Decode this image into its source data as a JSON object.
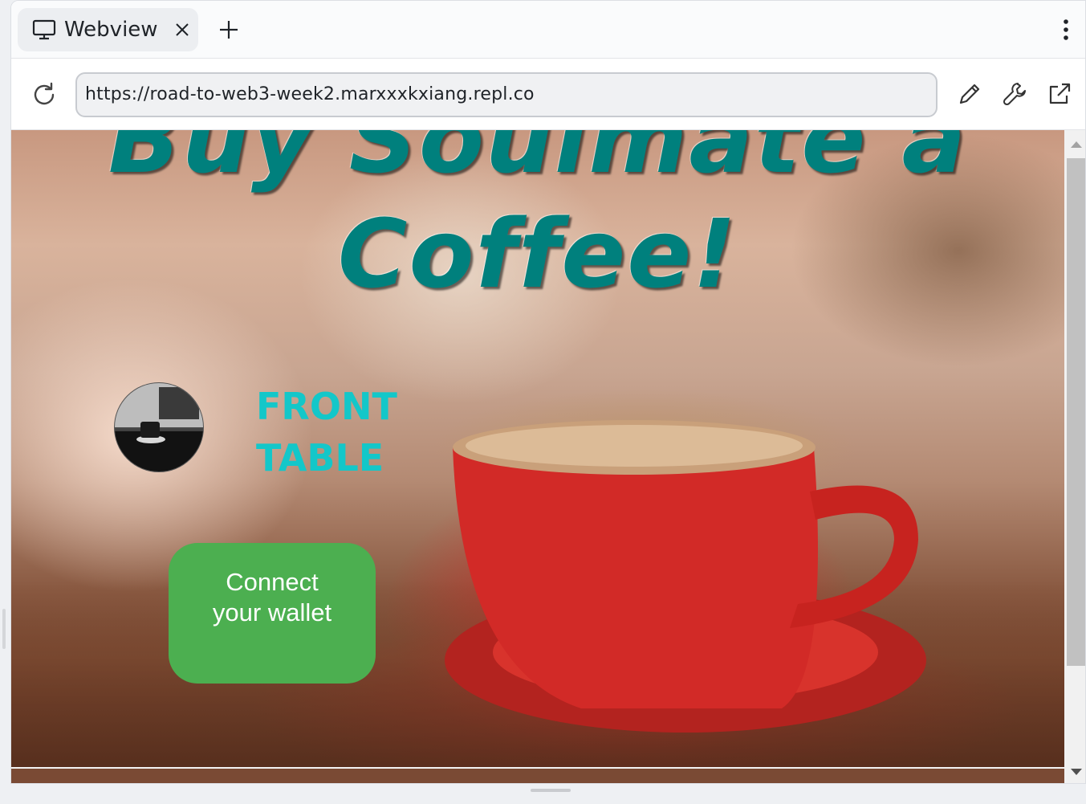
{
  "tabbar": {
    "tab_title": "Webview",
    "tab_icon": "monitor-icon",
    "close_icon": "close-icon",
    "new_tab_icon": "plus-icon",
    "menu_icon": "kebab-menu-icon"
  },
  "navbar": {
    "reload_icon": "reload-icon",
    "url": "https://road-to-web3-week2.marxxxkxiang.repl.co",
    "tools": [
      "pencil-icon",
      "wrench-icon",
      "external-link-icon"
    ]
  },
  "page": {
    "headline_line1": "Buy Soulmate a",
    "headline_line2": "Coffee!",
    "brand_line1": "FRONT",
    "brand_line2": "TABLE",
    "connect_button": "Connect your wallet"
  },
  "colors": {
    "headline": "#00807d",
    "brand": "#13c7c9",
    "button": "#4caf50"
  }
}
